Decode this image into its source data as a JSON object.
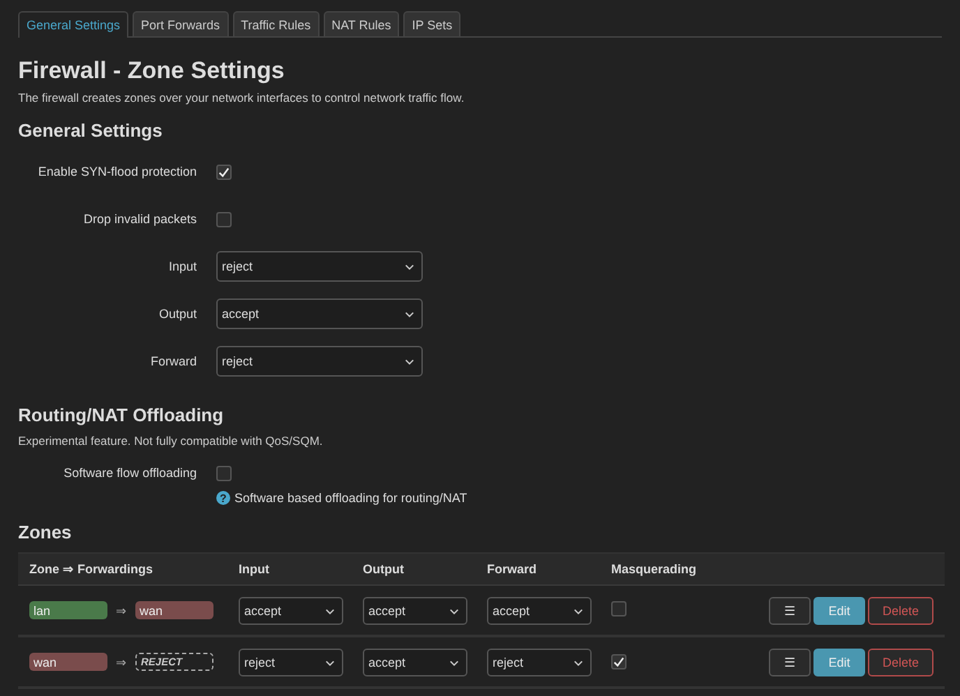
{
  "tabs": [
    {
      "label": "General Settings",
      "selected": true
    },
    {
      "label": "Port Forwards",
      "selected": false
    },
    {
      "label": "Traffic Rules",
      "selected": false
    },
    {
      "label": "NAT Rules",
      "selected": false
    },
    {
      "label": "IP Sets",
      "selected": false
    }
  ],
  "title": "Firewall - Zone Settings",
  "description": "The firewall creates zones over your network interfaces to control network traffic flow.",
  "general": {
    "heading": "General Settings",
    "fields": [
      {
        "kind": "checkbox",
        "label": "Enable SYN-flood protection",
        "checked": true
      },
      {
        "kind": "checkbox",
        "label": "Drop invalid packets",
        "checked": false
      },
      {
        "kind": "select",
        "label": "Input",
        "value": "reject"
      },
      {
        "kind": "select",
        "label": "Output",
        "value": "accept"
      },
      {
        "kind": "select",
        "label": "Forward",
        "value": "reject"
      }
    ]
  },
  "offloading": {
    "heading": "Routing/NAT Offloading",
    "description": "Experimental feature. Not fully compatible with QoS/SQM.",
    "label": "Software flow offloading",
    "checked": false,
    "help_icon": "?",
    "help": "Software based offloading for routing/NAT"
  },
  "zones": {
    "heading": "Zones",
    "columns": [
      "Zone ⇒ Forwardings",
      "Input",
      "Output",
      "Forward",
      "Masquerading"
    ],
    "rows": [
      {
        "zone": {
          "name": "lan",
          "color": "#4a7a4a"
        },
        "arrow": "⇒",
        "forward": {
          "kind": "zone",
          "name": "wan",
          "color": "#7a4c4c"
        },
        "input": "accept",
        "output": "accept",
        "forward_policy": "accept",
        "masquerading": false,
        "actions": [
          "☰",
          "Edit",
          "Delete"
        ]
      },
      {
        "zone": {
          "name": "wan",
          "color": "#7a4c4c"
        },
        "arrow": "⇒",
        "forward": {
          "kind": "reject",
          "name": "REJECT"
        },
        "input": "reject",
        "output": "accept",
        "forward_policy": "reject",
        "masquerading": true,
        "actions": [
          "☰",
          "Edit",
          "Delete"
        ]
      }
    ]
  }
}
